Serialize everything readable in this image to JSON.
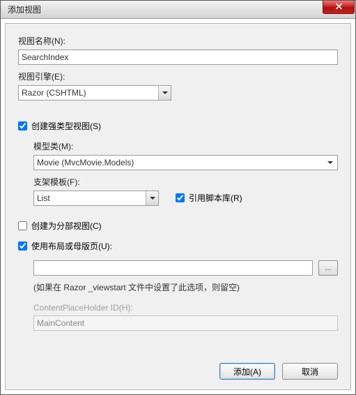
{
  "title": "添加视图",
  "fields": {
    "view_name_label": "视图名称(N):",
    "view_name_value": "SearchIndex",
    "view_engine_label": "视图引擎(E):",
    "view_engine_value": "Razor (CSHTML)",
    "strongly_typed_label": "创建强类型视图(S)",
    "model_class_label": "模型类(M):",
    "model_class_value": "Movie (MvcMovie.Models)",
    "scaffold_label": "支架模板(F):",
    "scaffold_value": "List",
    "reference_scripts_label": "引用脚本库(R)",
    "partial_view_label": "创建为分部视图(C)",
    "use_layout_label": "使用布局或母版页(U):",
    "layout_path_value": "",
    "layout_hint": "(如果在 Razor _viewstart 文件中设置了此选项，则留空)",
    "cph_label": "ContentPlaceHolder ID(H):",
    "cph_value": "MainContent"
  },
  "checks": {
    "strongly_typed": true,
    "reference_scripts": true,
    "partial_view": false,
    "use_layout": true
  },
  "buttons": {
    "browse": "...",
    "add": "添加(A)",
    "cancel": "取消"
  }
}
